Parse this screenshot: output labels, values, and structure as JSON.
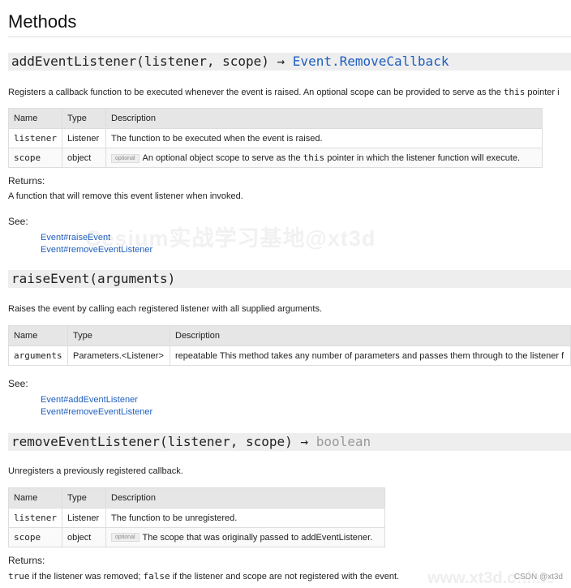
{
  "page": {
    "title": "Methods"
  },
  "watermark": {
    "center": "Cesium实战学习基地@xt3d",
    "corner_site": "www.xt3d.online",
    "corner_label": "CSDN @xt3d"
  },
  "common": {
    "th_name": "Name",
    "th_type": "Type",
    "th_desc": "Description",
    "optional": "optional",
    "returns": "Returns:",
    "see": "See:"
  },
  "m1": {
    "name": "addEventListener(listener, scope)",
    "arrow": " → ",
    "ret": "Event.RemoveCallback",
    "desc_pre": "Registers a callback function to be executed whenever the event is raised. An optional scope can be provided to serve as the ",
    "desc_code": "this",
    "desc_post": " pointer i",
    "rows": [
      {
        "name": "listener",
        "type": "Listener",
        "desc": "The function to be executed when the event is raised."
      },
      {
        "name": "scope",
        "type": "object",
        "desc_pre": "An optional object scope to serve as the ",
        "desc_code": "this",
        "desc_post": " pointer in which the listener function will execute."
      }
    ],
    "returns_text": "A function that will remove this event listener when invoked.",
    "see": [
      "Event#raiseEvent",
      "Event#removeEventListener"
    ]
  },
  "m2": {
    "name": "raiseEvent(arguments)",
    "desc": "Raises the event by calling each registered listener with all supplied arguments.",
    "rows": [
      {
        "name": "arguments",
        "type": "Parameters.<Listener>",
        "desc": "repeatable This method takes any number of parameters and passes them through to the listener f"
      }
    ],
    "see": [
      "Event#addEventListener",
      "Event#removeEventListener"
    ]
  },
  "m3": {
    "name": "removeEventListener(listener, scope)",
    "arrow": " → ",
    "ret": "boolean",
    "desc": "Unregisters a previously registered callback.",
    "rows": [
      {
        "name": "listener",
        "type": "Listener",
        "desc": "The function to be unregistered."
      },
      {
        "name": "scope",
        "type": "object",
        "desc": "The scope that was originally passed to addEventListener."
      }
    ],
    "returns_true": "true",
    "returns_mid": " if the listener was removed; ",
    "returns_false": "false",
    "returns_end": " if the listener and scope are not registered with the event."
  }
}
